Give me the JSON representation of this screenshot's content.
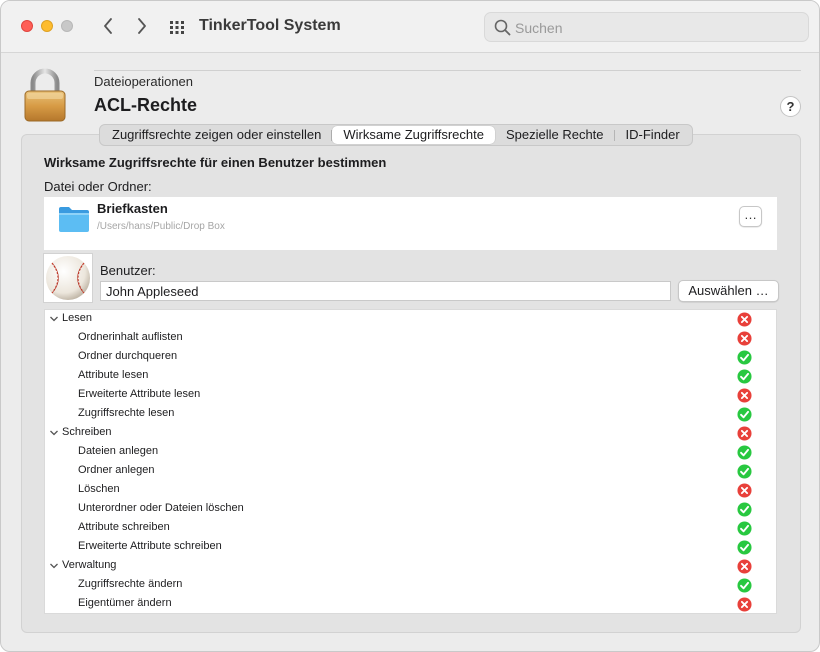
{
  "window": {
    "title": "TinkerTool System",
    "search_placeholder": "Suchen"
  },
  "header": {
    "section": "Dateioperationen",
    "title": "ACL-Rechte",
    "help_label": "?"
  },
  "tabs": [
    {
      "label": "Zugriffsrechte zeigen oder einstellen",
      "active": false
    },
    {
      "label": "Wirksame Zugriffsrechte",
      "active": true
    },
    {
      "label": "Spezielle Rechte",
      "active": false
    },
    {
      "label": "ID-Finder",
      "active": false
    }
  ],
  "panel": {
    "heading": "Wirksame Zugriffsrechte für einen Benutzer bestimmen",
    "file_label": "Datei oder Ordner:",
    "file": {
      "name": "Briefkasten",
      "path": "/Users/hans/Public/Drop Box",
      "more_label": "…"
    },
    "user_label": "Benutzer:",
    "user_value": "John Appleseed",
    "choose_label": "Auswählen …"
  },
  "permissions": [
    {
      "label": "Lesen",
      "group": true,
      "granted": false
    },
    {
      "label": "Ordnerinhalt auflisten",
      "group": false,
      "granted": false
    },
    {
      "label": "Ordner durchqueren",
      "group": false,
      "granted": true
    },
    {
      "label": "Attribute lesen",
      "group": false,
      "granted": true
    },
    {
      "label": "Erweiterte Attribute lesen",
      "group": false,
      "granted": false
    },
    {
      "label": "Zugriffsrechte lesen",
      "group": false,
      "granted": true
    },
    {
      "label": "Schreiben",
      "group": true,
      "granted": false
    },
    {
      "label": "Dateien anlegen",
      "group": false,
      "granted": true
    },
    {
      "label": "Ordner anlegen",
      "group": false,
      "granted": true
    },
    {
      "label": "Löschen",
      "group": false,
      "granted": false
    },
    {
      "label": "Unterordner oder Dateien löschen",
      "group": false,
      "granted": true
    },
    {
      "label": "Attribute schreiben",
      "group": false,
      "granted": true
    },
    {
      "label": "Erweiterte Attribute schreiben",
      "group": false,
      "granted": true
    },
    {
      "label": "Verwaltung",
      "group": true,
      "granted": false
    },
    {
      "label": "Zugriffsrechte ändern",
      "group": false,
      "granted": true
    },
    {
      "label": "Eigentümer ändern",
      "group": false,
      "granted": false
    }
  ],
  "colors": {
    "granted": "#28c840",
    "denied": "#e8403a",
    "folder": "#4fb3ef"
  }
}
